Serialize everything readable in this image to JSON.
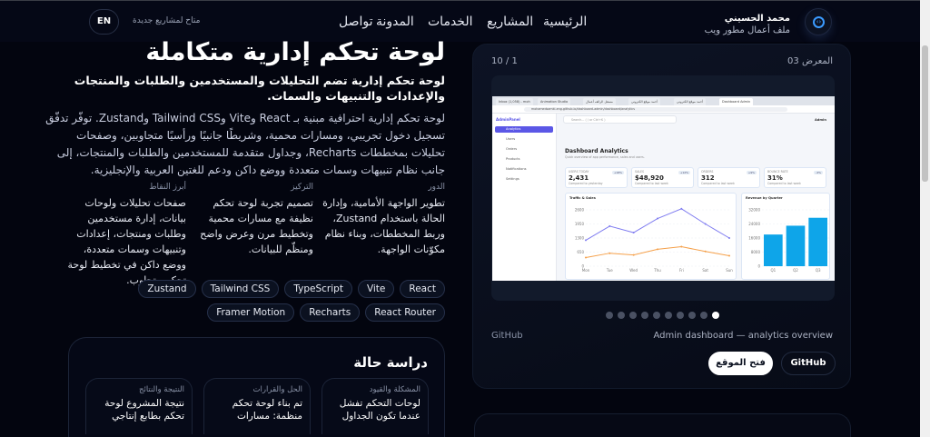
{
  "header": {
    "name": "محمد الحسيني",
    "subtitle": "ملف أعمال مطور ويب",
    "logo_icon": "code-icon",
    "nav": [
      "الرئيسية",
      "المشاريع",
      "الخدمات",
      "المدونة",
      "تواصل"
    ],
    "availability": "متاح لمشاريع جديدة",
    "lang_button": "EN"
  },
  "project": {
    "title": "لوحة تحكم إدارية متكاملة",
    "subtitle": "لوحة تحكم إدارية تضم التحليلات والمستخدمين والطلبات والمنتجات والإعدادات والتنبيهات والسمات.",
    "description": "لوحة تحكم إدارية احترافية مبنية بـ React وVite وTailwind CSS وZustand. توفّر تدفّق تسجيل دخول تجريبي، ومسارات محمية، وشريطًا جانبيًا ورأسيًا متجاوبين، وصفحات تحليلات بمخططات Recharts، وجداول متقدمة للمستخدمين والطلبات والمنتجات، إلى جانب نظام تنبيهات وسمات متعددة ووضع داكن ودعم للغتين العربية والإنجليزية.",
    "columns": [
      {
        "label": "الدور",
        "text": "تطوير الواجهة الأمامية، وإدارة الحالة باستخدام Zustand، وربط المخططات، وبناء نظام مكوّنات الواجهة."
      },
      {
        "label": "التركيز",
        "text": "تصميم تجربة لوحة تحكم نظيفة مع مسارات محمية وتخطيط مرن وعرض واضح ومنظّم للبيانات."
      },
      {
        "label": "أبرز النقاط",
        "text": "صفحات تحليلات ولوحات بيانات، إدارة مستخدمين وطلبات ومنتجات، إعدادات وتنبيهات وسمات متعددة، ووضع داكن في تخطيط لوحة تحكم متجاوب."
      }
    ],
    "tags": [
      "React",
      "Vite",
      "TypeScript",
      "Tailwind CSS",
      "Zustand",
      "React Router",
      "Recharts",
      "Framer Motion"
    ]
  },
  "case_study": {
    "title": "دراسة حالة",
    "cards": [
      {
        "label": "المشكلة والقيود",
        "text": "لوحات التحكم تفشل عندما تكون الجداول"
      },
      {
        "label": "الحل والقرارات",
        "text": "تم بناء لوحة تحكم منظمة: مسارات"
      },
      {
        "label": "النتيجة والنتائج",
        "text": "نتيجة المشروع لوحة تحكم بطابع إنتاجي"
      }
    ]
  },
  "gallery": {
    "label": "المعرض 03",
    "counter": "10 / 1",
    "slide_count": 10,
    "active_slide": 10,
    "caption_left": "GitHub",
    "caption_right": "Admin dashboard — analytics overview",
    "github_button": "GitHub",
    "open_site_button": "فتح الموقع"
  },
  "screenshot": {
    "tabs": [
      "Inbox (1,058) - moh",
      "Animation Studio",
      "مسقل الرائف أعمال",
      "أحمد موقع الكتروني",
      "أحمد موقع الكتروني",
      "Dashboard Admin"
    ],
    "url": "mohamedsamki-eng.github.io/dashboard-admin/dashboard/analytics",
    "brand": "AdminPanel",
    "search": "Search... ( / or Ctrl+K )",
    "user": "Admin",
    "menu": [
      "Analytics",
      "Users",
      "Orders",
      "Products",
      "Notifications",
      "Settings"
    ],
    "heading": "Dashboard Analytics",
    "subheading": "Quick overview of app performance, sales and users.",
    "stats": [
      {
        "label": "USERS TODAY",
        "value": "2,431",
        "badge": "+18%",
        "note": "Compared to yesterday"
      },
      {
        "label": "SALES",
        "value": "$48,920",
        "badge": "+12%",
        "note": "Compared to last week"
      },
      {
        "label": "ORDERS",
        "value": "312",
        "badge": "+9%",
        "note": "Compared to last week"
      },
      {
        "label": "BOUNCE RATE",
        "value": "31%",
        "badge": "-4%",
        "note": "Compared to last week"
      }
    ],
    "line_chart": {
      "title": "Traffic & Sales",
      "x": [
        "Mon",
        "Tue",
        "Wed",
        "Thu",
        "Fri",
        "Sat",
        "Sun"
      ],
      "yticks": [
        "0",
        "650",
        "1300",
        "1950",
        "2600"
      ],
      "ymax": 2600,
      "traffic": [
        1200,
        1850,
        1550,
        2200,
        2650,
        1950,
        1300
      ],
      "sales": [
        400,
        600,
        520,
        780,
        900,
        680,
        480
      ]
    },
    "bar_chart": {
      "title": "Revenue by Quarter",
      "x": [
        "Q1",
        "Q2",
        "Q3"
      ],
      "yticks": [
        "0",
        "8000",
        "16000",
        "24000",
        "32000"
      ],
      "ymax": 32000,
      "values": [
        18000,
        23000,
        27500
      ]
    }
  },
  "colors": {
    "accent": "#5b57e6",
    "traffic": "#7f7cf0",
    "sales": "#f5a04a",
    "bars": "#0ea5e9"
  }
}
